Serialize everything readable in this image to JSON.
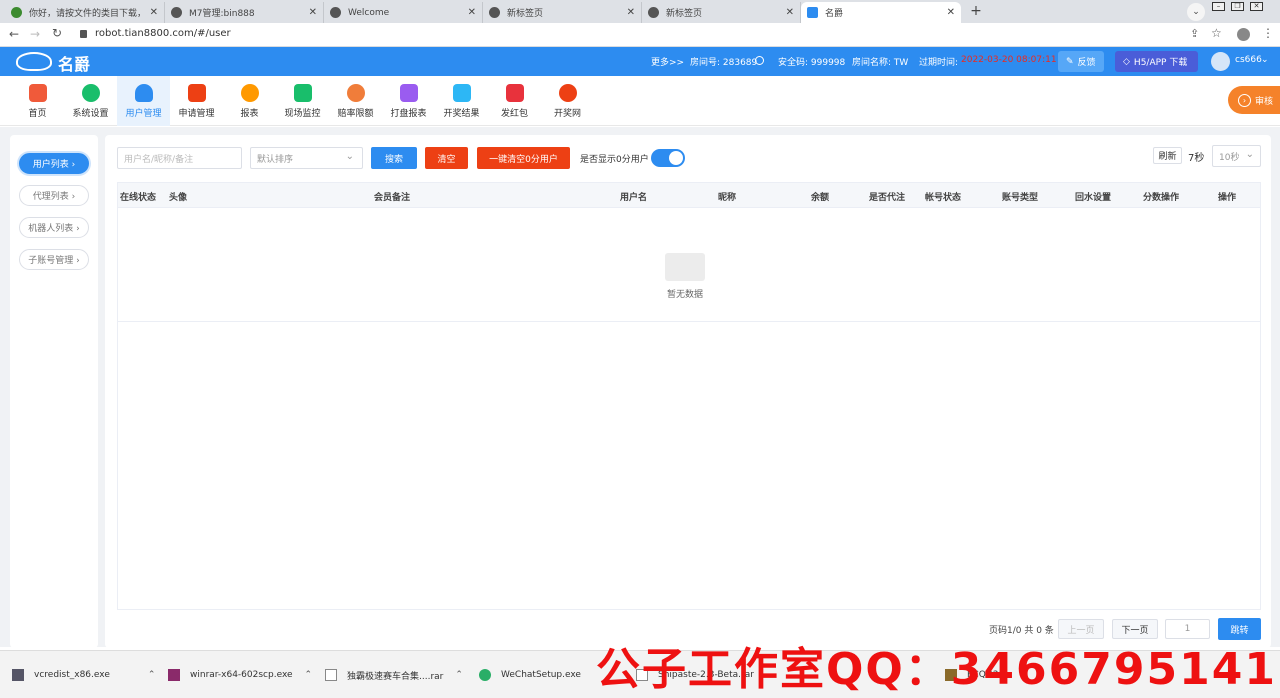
{
  "browser": {
    "tabs": [
      {
        "title": "你好，请按文件的类目下载，对..."
      },
      {
        "title": "M7管理:bin888"
      },
      {
        "title": "Welcome"
      },
      {
        "title": "新标签页"
      },
      {
        "title": "新标签页"
      },
      {
        "title": "名爵"
      }
    ],
    "url": "robot.tian8800.com/#/user",
    "close_glyph": "✕",
    "new_tab_glyph": "+"
  },
  "header": {
    "logo_text": "名爵",
    "more": "更多>>",
    "room_no": "房间号: 283689",
    "security_code": "安全码: 999998",
    "room_name": "房间名称: TW",
    "expire_label": "过期时间:",
    "expire_value": "2022-03-20 08:07:11",
    "feedback": "反馈",
    "h5_download": "H5/APP 下载",
    "username": "cs666"
  },
  "nav": {
    "items": [
      {
        "label": "首页",
        "color": "#f05a3a"
      },
      {
        "label": "系统设置",
        "color": "#19be6b"
      },
      {
        "label": "用户管理",
        "color": "#2d8cf0"
      },
      {
        "label": "申请管理",
        "color": "#ed4014"
      },
      {
        "label": "报表",
        "color": "#ff9900"
      },
      {
        "label": "现场监控",
        "color": "#19be6b"
      },
      {
        "label": "赔率限额",
        "color": "#f07d3a"
      },
      {
        "label": "打盘报表",
        "color": "#9a5cf0"
      },
      {
        "label": "开奖结果",
        "color": "#2db7f5"
      },
      {
        "label": "发红包",
        "color": "#e8323c"
      },
      {
        "label": "开奖网",
        "color": "#ed4014"
      }
    ],
    "audit": "审核"
  },
  "sidemenu": {
    "items": [
      {
        "label": "用户列表 ›"
      },
      {
        "label": "代理列表 ›"
      },
      {
        "label": "机器人列表 ›"
      },
      {
        "label": "子账号管理 ›"
      }
    ]
  },
  "filters": {
    "search_placeholder": "用户名/昵称/备注",
    "sort_value": "默认排序",
    "search_btn": "搜索",
    "clear_btn": "清空",
    "clear_zero_btn": "一键清空0分用户",
    "show_zero_label": "是否显示0分用户",
    "refresh_btn": "刷新",
    "countdown": "7秒",
    "interval_value": "10秒"
  },
  "table": {
    "columns": [
      "在线状态",
      "头像",
      "会员备注",
      "用户名",
      "昵称",
      "余额",
      "是否代注",
      "帐号状态",
      "账号类型",
      "回水设置",
      "分数操作",
      "操作"
    ],
    "empty_text": "暂无数据"
  },
  "pagination": {
    "info": "页码1/0 共 0 条",
    "prev": "上一页",
    "next": "下一页",
    "page_value": "1",
    "jump": "跳转"
  },
  "downloads": [
    {
      "name": "vcredist_x86.exe"
    },
    {
      "name": "winrar-x64-602scp.exe"
    },
    {
      "name": "独霸极速赛车合集....rar"
    },
    {
      "name": "WeChatSetup.exe"
    },
    {
      "name": "Snipaste-2.3-Beta.rar"
    },
    {
      "name": "PCQQ20..."
    }
  ],
  "watermark": "公子工作室QQ：3466795141"
}
